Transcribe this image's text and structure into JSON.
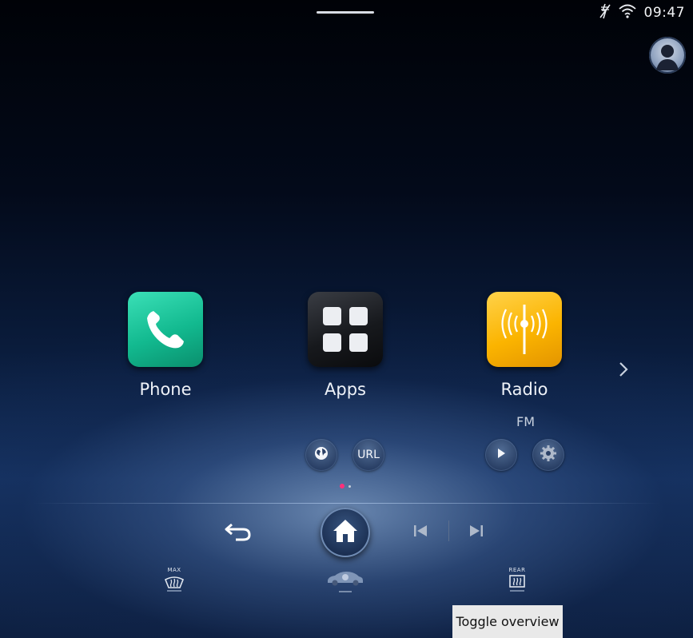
{
  "status_bar": {
    "time": "09:47",
    "icons": [
      "no-location-icon",
      "wifi-icon"
    ]
  },
  "profile": {
    "icon": "user-avatar-icon"
  },
  "apps": [
    {
      "label": "Phone",
      "icon": "phone-icon",
      "color": "#14c596"
    },
    {
      "label": "Apps",
      "icon": "grid-icon",
      "color": "#1a1c20"
    },
    {
      "label": "Radio",
      "icon": "antenna-icon",
      "color": "#fbb400",
      "sublabel": "FM"
    }
  ],
  "quick_actions": {
    "apps": [
      {
        "icon": "globe-icon"
      },
      {
        "label": "URL"
      }
    ],
    "radio": [
      {
        "icon": "play-icon"
      },
      {
        "icon": "gear-icon"
      }
    ]
  },
  "pagination": {
    "pages": 2,
    "current": 1,
    "active_color": "#ff2e7a"
  },
  "nav_bar": {
    "back": "back-arrow-icon",
    "home": "home-icon",
    "previous": "skip-previous-icon",
    "next": "skip-next-icon"
  },
  "climate": {
    "front_defrost": {
      "label": "MAX",
      "icon": "front-defrost-icon"
    },
    "car_overview": {
      "icon": "car-icon"
    },
    "rear_defrost": {
      "label": "REAR",
      "icon": "rear-defrost-icon"
    }
  },
  "tooltip": {
    "text": "Toggle overview"
  }
}
